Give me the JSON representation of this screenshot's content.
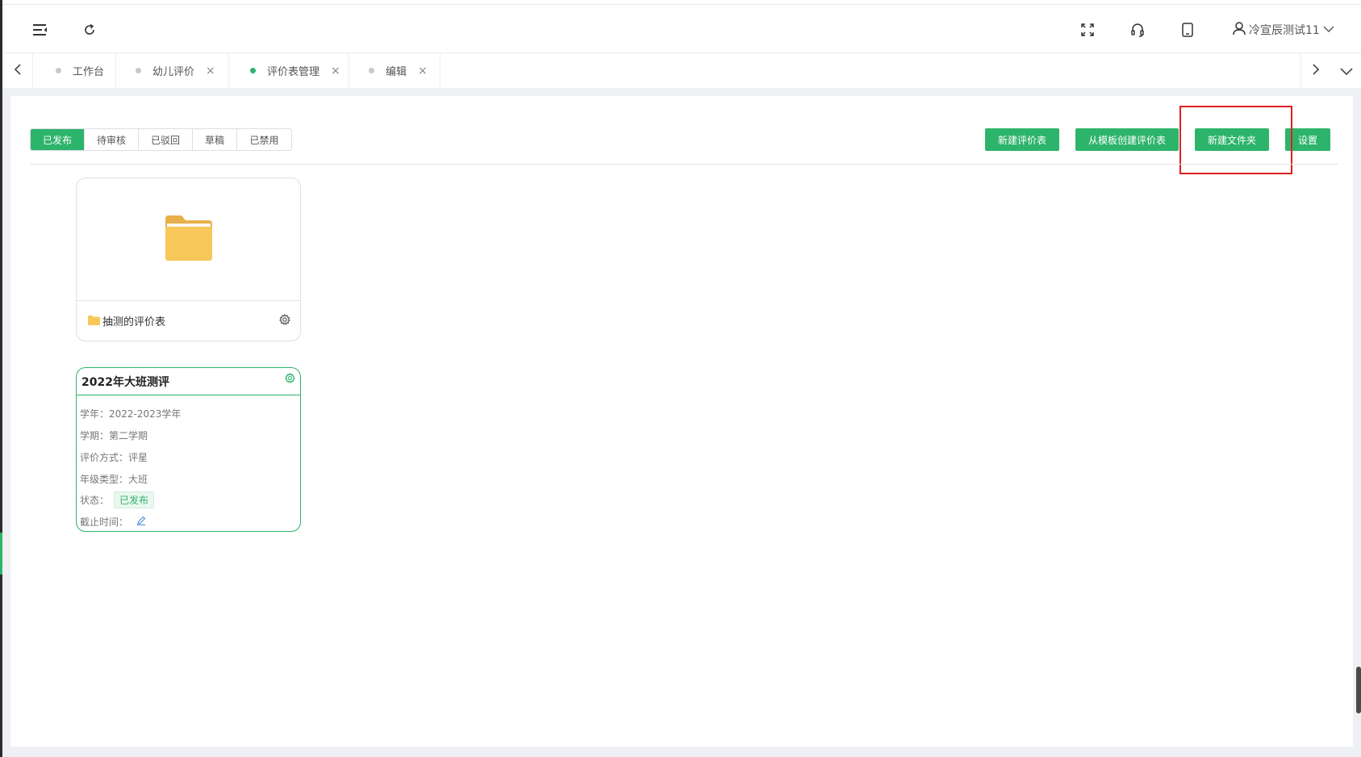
{
  "header": {
    "user_name": "冷宣辰测试11",
    "icons": [
      "menu-fold-icon",
      "refresh-icon",
      "fullscreen-icon",
      "headset-icon",
      "tablet-icon",
      "user-icon",
      "chevron-down-icon"
    ]
  },
  "tabs": [
    {
      "label": "工作台",
      "closable": false,
      "active": false
    },
    {
      "label": "幼儿评价",
      "closable": true,
      "active": false
    },
    {
      "label": "评价表管理",
      "closable": true,
      "active": true
    },
    {
      "label": "编辑",
      "closable": true,
      "active": false
    }
  ],
  "tab_close_glyph": "×",
  "filters": [
    {
      "label": "已发布",
      "active": true
    },
    {
      "label": "待审核",
      "active": false
    },
    {
      "label": "已驳回",
      "active": false
    },
    {
      "label": "草稿",
      "active": false
    },
    {
      "label": "已禁用",
      "active": false
    }
  ],
  "actions": {
    "new_form": "新建评价表",
    "from_template": "从模板创建评价表",
    "new_folder": "新建文件夹",
    "settings": "设置"
  },
  "folder": {
    "name": "抽测的评价表"
  },
  "eval_card": {
    "title": "2022年大班测评",
    "school_year_label": "学年：",
    "school_year": "2022-2023学年",
    "semester_label": "学期：",
    "semester": "第二学期",
    "method_label": "评价方式：",
    "method": "评星",
    "grade_label": "年级类型：",
    "grade": "大班",
    "status_label": "状态：",
    "status": "已发布",
    "deadline_label": "截止时间："
  },
  "colors": {
    "accent": "#2db46b",
    "highlight": "#e02020",
    "folder": "#f8c75a"
  }
}
